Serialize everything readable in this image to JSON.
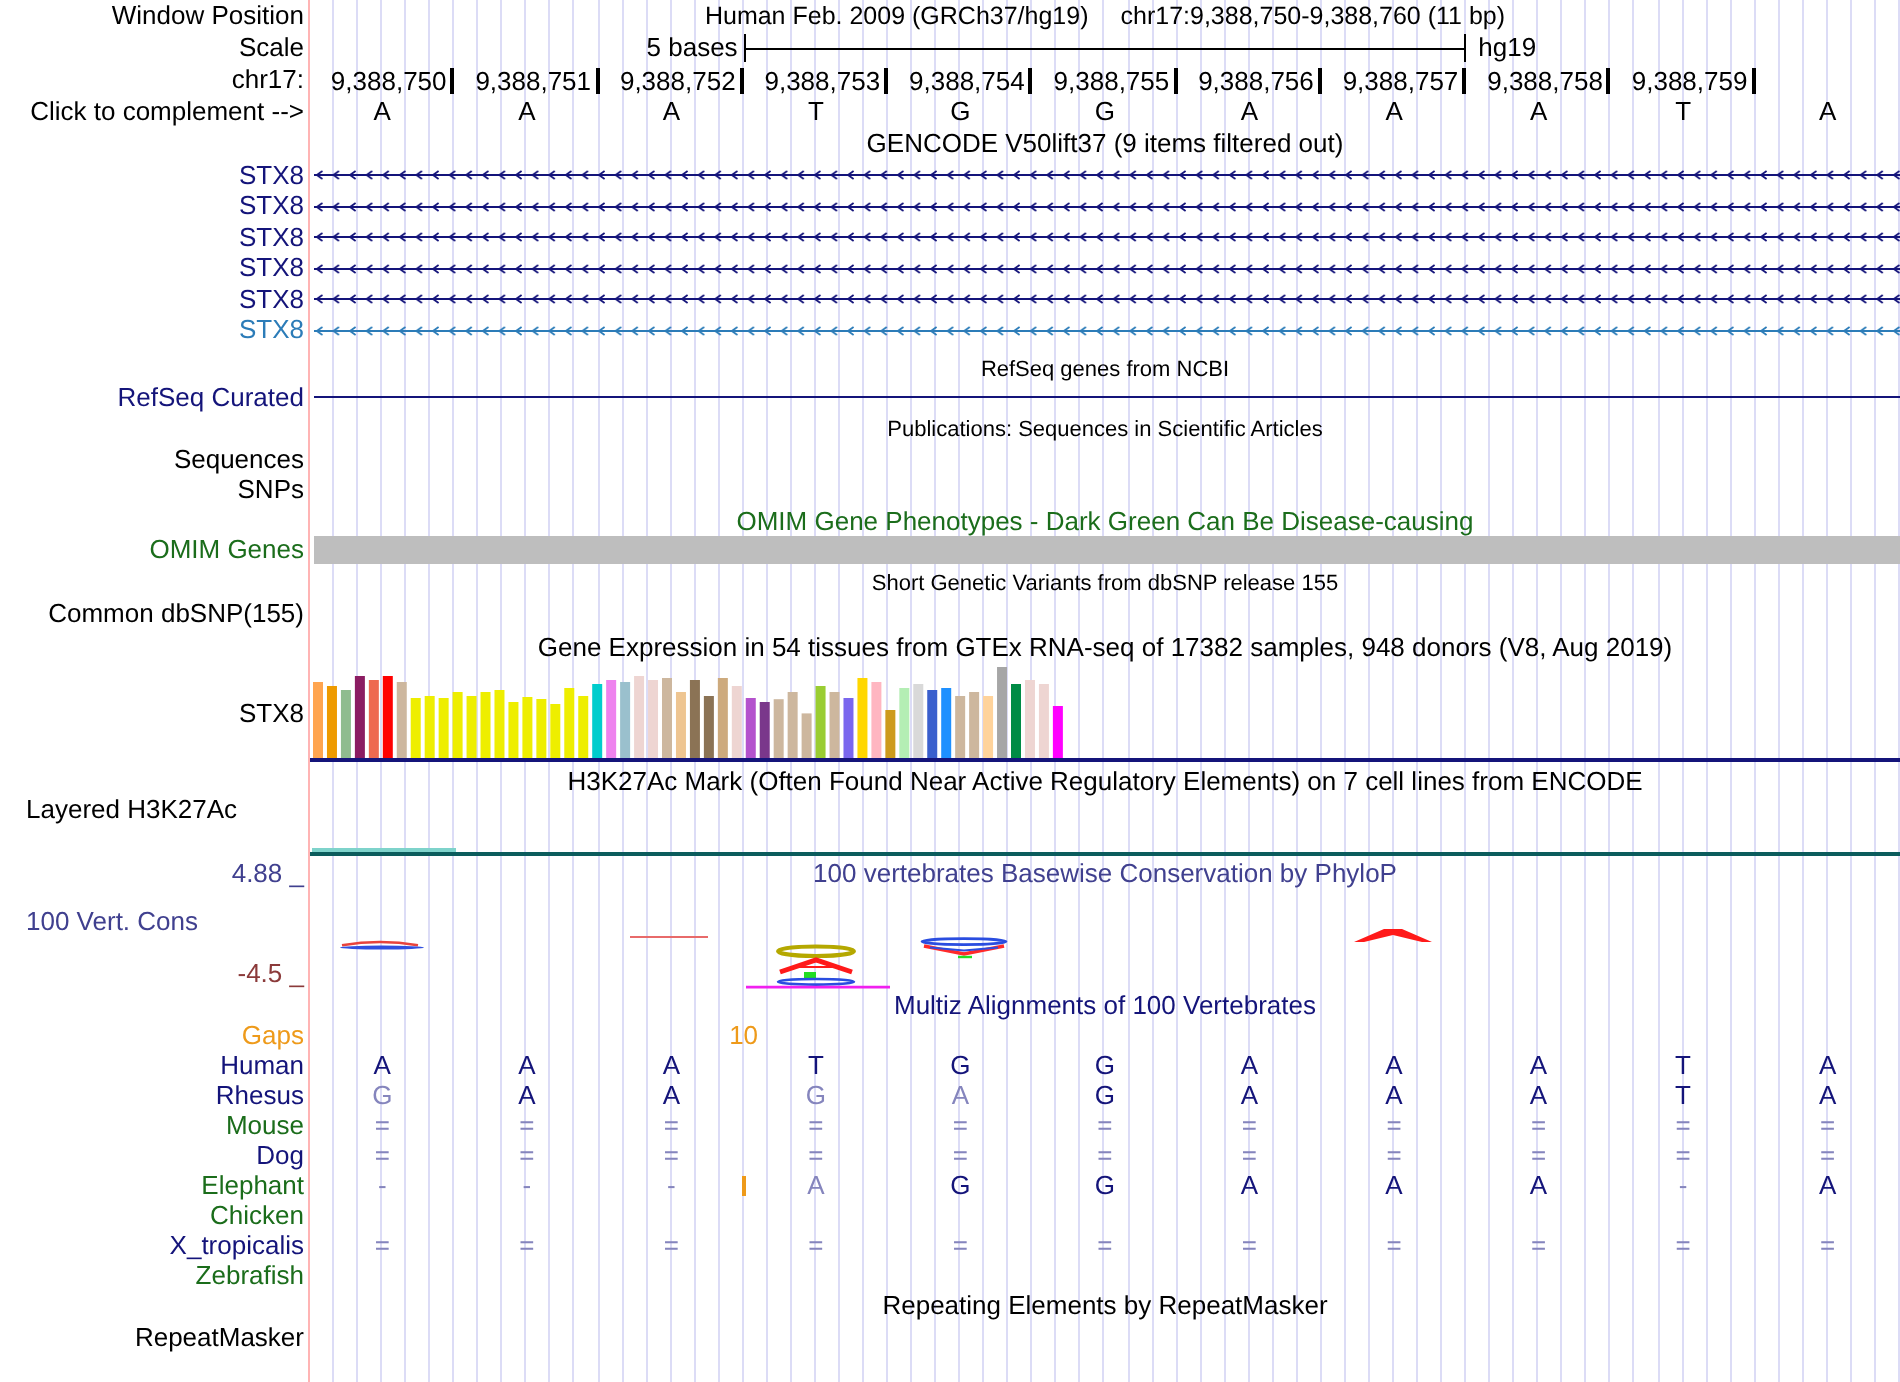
{
  "header": {
    "label": "Window Position",
    "assembly": "Human Feb. 2009 (GRCh37/hg19)",
    "position": "chr17:9,388,750-9,388,760 (11 bp)"
  },
  "scale": {
    "label": "Scale",
    "length": "5 bases",
    "assembly": "hg19"
  },
  "ruler": {
    "label": "chr17:",
    "positions": [
      "9,388,750",
      "9,388,751",
      "9,388,752",
      "9,388,753",
      "9,388,754",
      "9,388,755",
      "9,388,756",
      "9,388,757",
      "9,388,758",
      "9,388,759"
    ]
  },
  "sequence": {
    "label": "Click to complement -->",
    "bases": [
      "A",
      "A",
      "A",
      "T",
      "G",
      "G",
      "A",
      "A",
      "A",
      "T",
      "A"
    ]
  },
  "tracks": [
    {
      "kind": "genes",
      "title": "GENCODE V50lift37 (9 items filtered out)",
      "items": [
        {
          "name": "STX8",
          "color": "#14147a"
        },
        {
          "name": "STX8",
          "color": "#14147a"
        },
        {
          "name": "STX8",
          "color": "#14147a"
        },
        {
          "name": "STX8",
          "color": "#14147a"
        },
        {
          "name": "STX8",
          "color": "#14147a"
        },
        {
          "name": "STX8",
          "color": "#2c7cb8"
        }
      ]
    },
    {
      "kind": "line",
      "title": "RefSeq genes from NCBI",
      "label": "RefSeq Curated",
      "color": "#14147a"
    },
    {
      "kind": "annotation",
      "title": "Publications: Sequences in Scientific Articles",
      "labels": [
        "Sequences",
        "SNPs"
      ]
    },
    {
      "kind": "bar",
      "title": "OMIM Gene Phenotypes - Dark Green Can Be Disease-causing",
      "label": "OMIM Genes",
      "color": "#1b6d1b"
    },
    {
      "kind": "annotation",
      "title": "Short Genetic Variants from dbSNP release 155",
      "labels": [
        "Common dbSNP(155)"
      ]
    },
    {
      "kind": "expression",
      "title": "Gene Expression in 54 tissues from GTEx RNA-seq of 17382 samples, 948 donors (V8, Aug 2019)",
      "label": "STX8"
    },
    {
      "kind": "signal",
      "title": "H3K27Ac Mark (Often Found Near Active Regulatory Elements) on 7 cell lines from ENCODE",
      "label": "Layered H3K27Ac"
    },
    {
      "kind": "conservation",
      "title": "100 vertebrates Basewise Conservation by PhyloP",
      "label": "100 Vert. Cons",
      "max": "4.88 _",
      "min": "-4.5 _",
      "color": "#40408f"
    },
    {
      "kind": "alignment",
      "title": "Multiz Alignments of 100 Vertebrates",
      "color": "#14147a",
      "gaps": {
        "label": "Gaps",
        "cells": [
          {
            "kind": "blank"
          },
          {
            "kind": "blank"
          },
          {
            "kind": "blank"
          },
          {
            "kind": "count",
            "text": "10"
          },
          {
            "kind": "blank"
          },
          {
            "kind": "blank"
          },
          {
            "kind": "blank"
          },
          {
            "kind": "blank"
          },
          {
            "kind": "blank"
          },
          {
            "kind": "blank"
          },
          {
            "kind": "blank"
          },
          {
            "kind": "blank"
          }
        ]
      },
      "species": [
        {
          "name": "Human",
          "color": "#14147a",
          "cells": [
            {
              "kind": "base",
              "text": "A",
              "faded": false
            },
            {
              "kind": "base",
              "text": "A",
              "faded": false
            },
            {
              "kind": "base",
              "text": "A",
              "faded": false
            },
            {
              "kind": "base",
              "text": "T",
              "faded": false
            },
            {
              "kind": "base",
              "text": "G",
              "faded": false
            },
            {
              "kind": "base",
              "text": "G",
              "faded": false
            },
            {
              "kind": "base",
              "text": "A",
              "faded": false
            },
            {
              "kind": "base",
              "text": "A",
              "faded": false
            },
            {
              "kind": "base",
              "text": "A",
              "faded": false
            },
            {
              "kind": "base",
              "text": "T",
              "faded": false
            },
            {
              "kind": "base",
              "text": "A",
              "faded": false
            }
          ]
        },
        {
          "name": "Rhesus",
          "color": "#14147a",
          "cells": [
            {
              "kind": "base",
              "text": "G",
              "faded": true
            },
            {
              "kind": "base",
              "text": "A",
              "faded": false
            },
            {
              "kind": "base",
              "text": "A",
              "faded": false
            },
            {
              "kind": "base",
              "text": "G",
              "faded": true
            },
            {
              "kind": "base",
              "text": "A",
              "faded": true
            },
            {
              "kind": "base",
              "text": "G",
              "faded": false
            },
            {
              "kind": "base",
              "text": "A",
              "faded": false
            },
            {
              "kind": "base",
              "text": "A",
              "faded": false
            },
            {
              "kind": "base",
              "text": "A",
              "faded": false
            },
            {
              "kind": "base",
              "text": "T",
              "faded": false
            },
            {
              "kind": "base",
              "text": "A",
              "faded": false
            }
          ]
        },
        {
          "name": "Mouse",
          "color": "#1b6d1b",
          "cells": [
            {
              "kind": "base",
              "text": "=",
              "faded": true
            },
            {
              "kind": "base",
              "text": "=",
              "faded": true
            },
            {
              "kind": "base",
              "text": "=",
              "faded": true
            },
            {
              "kind": "base",
              "text": "=",
              "faded": true
            },
            {
              "kind": "base",
              "text": "=",
              "faded": true
            },
            {
              "kind": "base",
              "text": "=",
              "faded": true
            },
            {
              "kind": "base",
              "text": "=",
              "faded": true
            },
            {
              "kind": "base",
              "text": "=",
              "faded": true
            },
            {
              "kind": "base",
              "text": "=",
              "faded": true
            },
            {
              "kind": "base",
              "text": "=",
              "faded": true
            },
            {
              "kind": "base",
              "text": "=",
              "faded": true
            }
          ]
        },
        {
          "name": "Dog",
          "color": "#14147a",
          "cells": [
            {
              "kind": "base",
              "text": "=",
              "faded": true
            },
            {
              "kind": "base",
              "text": "=",
              "faded": true
            },
            {
              "kind": "base",
              "text": "=",
              "faded": true
            },
            {
              "kind": "base",
              "text": "=",
              "faded": true
            },
            {
              "kind": "base",
              "text": "=",
              "faded": true
            },
            {
              "kind": "base",
              "text": "=",
              "faded": true
            },
            {
              "kind": "base",
              "text": "=",
              "faded": true
            },
            {
              "kind": "base",
              "text": "=",
              "faded": true
            },
            {
              "kind": "base",
              "text": "=",
              "faded": true
            },
            {
              "kind": "base",
              "text": "=",
              "faded": true
            },
            {
              "kind": "base",
              "text": "=",
              "faded": true
            }
          ]
        },
        {
          "name": "Elephant",
          "color": "#1b6d1b",
          "cells": [
            {
              "kind": "base",
              "text": "-",
              "faded": true
            },
            {
              "kind": "base",
              "text": "-",
              "faded": true
            },
            {
              "kind": "base",
              "text": "-",
              "faded": true
            },
            {
              "kind": "insertion"
            },
            {
              "kind": "base",
              "text": "A",
              "faded": true
            },
            {
              "kind": "base",
              "text": "G",
              "faded": false
            },
            {
              "kind": "base",
              "text": "G",
              "faded": false
            },
            {
              "kind": "base",
              "text": "A",
              "faded": false
            },
            {
              "kind": "base",
              "text": "A",
              "faded": false
            },
            {
              "kind": "base",
              "text": "A",
              "faded": false
            },
            {
              "kind": "base",
              "text": "-",
              "faded": true
            },
            {
              "kind": "base",
              "text": "A",
              "faded": false
            }
          ]
        },
        {
          "name": "Chicken",
          "color": "#1b6d1b"
        },
        {
          "name": "X_tropicalis",
          "color": "#14147a",
          "cells": [
            {
              "kind": "base",
              "text": "=",
              "faded": true
            },
            {
              "kind": "base",
              "text": "=",
              "faded": true
            },
            {
              "kind": "base",
              "text": "=",
              "faded": true
            },
            {
              "kind": "base",
              "text": "=",
              "faded": true
            },
            {
              "kind": "base",
              "text": "=",
              "faded": true
            },
            {
              "kind": "base",
              "text": "=",
              "faded": true
            },
            {
              "kind": "base",
              "text": "=",
              "faded": true
            },
            {
              "kind": "base",
              "text": "=",
              "faded": true
            },
            {
              "kind": "base",
              "text": "=",
              "faded": true
            },
            {
              "kind": "base",
              "text": "=",
              "faded": true
            },
            {
              "kind": "base",
              "text": "=",
              "faded": true
            }
          ]
        },
        {
          "name": "Zebrafish",
          "color": "#1b6d1b"
        }
      ]
    },
    {
      "kind": "repeats",
      "title": "Repeating Elements by RepeatMasker",
      "labels": [
        "RepeatMasker"
      ]
    }
  ]
}
